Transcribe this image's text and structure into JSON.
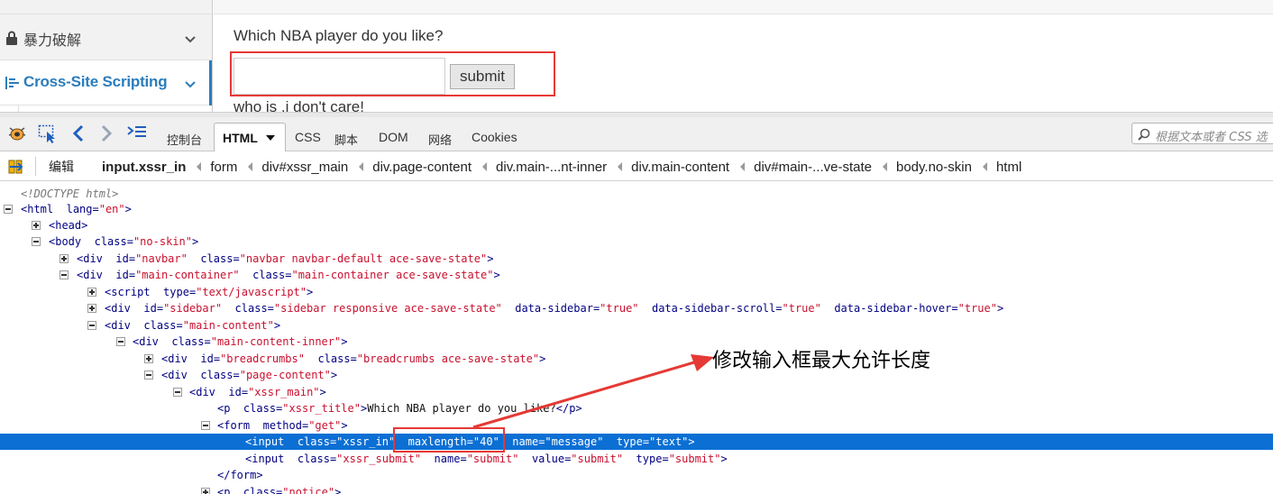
{
  "sidebar": {
    "items": [
      {
        "label": "暴力破解",
        "icon": "lock-icon",
        "active": false
      },
      {
        "label": "Cross-Site Scripting",
        "icon": "list-icon",
        "active": true
      }
    ]
  },
  "page": {
    "xss_title": "Which NBA player do you like?",
    "input_value": "",
    "submit_label": "submit",
    "notice": "who is ,i don't care!"
  },
  "devtools": {
    "tabs": {
      "console": "控制台",
      "html": "HTML",
      "css": "CSS",
      "script": "脚本",
      "dom": "DOM",
      "net": "网络",
      "cookies": "Cookies"
    },
    "search_placeholder": "根据文本或者 CSS 选",
    "edit_label": "编辑",
    "breadcrumbs": [
      "input.xssr_in",
      "form",
      "div#xssr_main",
      "div.page-content",
      "div.main-...nt-inner",
      "div.main-content",
      "div#main-...ve-state",
      "body.no-skin",
      "html"
    ],
    "tree": {
      "doctype": "<!DOCTYPE html>",
      "html": {
        "tag": "html",
        "attr1_name": "lang",
        "attr1_val": "\"en\""
      },
      "head": {
        "tag": "head"
      },
      "body": {
        "tag": "body",
        "attr1_name": "class",
        "attr1_val": "\"no-skin\""
      },
      "navbar": {
        "tag": "div",
        "attr1_name": "id",
        "attr1_val": "\"navbar\"",
        "attr2_name": "class",
        "attr2_val": "\"navbar navbar-default ace-save-state\""
      },
      "main_container": {
        "tag": "div",
        "attr1_name": "id",
        "attr1_val": "\"main-container\"",
        "attr2_name": "class",
        "attr2_val": "\"main-container ace-save-state\""
      },
      "script": {
        "tag": "script",
        "attr1_name": "type",
        "attr1_val": "\"text/javascript\""
      },
      "sidebar": {
        "tag": "div",
        "attr1_name": "id",
        "attr1_val": "\"sidebar\"",
        "attr2_name": "class",
        "attr2_val": "\"sidebar responsive ace-save-state\"",
        "attr3_name": "data-sidebar",
        "attr3_val": "\"true\"",
        "attr4_name": "data-sidebar-scroll",
        "attr4_val": "\"true\"",
        "attr5_name": "data-sidebar-hover",
        "attr5_val": "\"true\""
      },
      "main_content": {
        "tag": "div",
        "attr1_name": "class",
        "attr1_val": "\"main-content\""
      },
      "main_content_inner": {
        "tag": "div",
        "attr1_name": "class",
        "attr1_val": "\"main-content-inner\""
      },
      "breadcrumbs": {
        "tag": "div",
        "attr1_name": "id",
        "attr1_val": "\"breadcrumbs\"",
        "attr2_name": "class",
        "attr2_val": "\"breadcrumbs ace-save-state\""
      },
      "page_content": {
        "tag": "div",
        "attr1_name": "class",
        "attr1_val": "\"page-content\""
      },
      "xssr_main": {
        "tag": "div",
        "attr1_name": "id",
        "attr1_val": "\"xssr_main\""
      },
      "p_title": {
        "tag": "p",
        "attr1_name": "class",
        "attr1_val": "\"xssr_title\"",
        "text": "Which NBA player do you like?",
        "close": "p"
      },
      "form": {
        "tag": "form",
        "attr1_name": "method",
        "attr1_val": "\"get\""
      },
      "input_text": {
        "tag": "input",
        "attr1_name": "class",
        "attr1_val": "\"xssr_in\"",
        "attr2_name": "maxlength",
        "attr2_val": "\"40\"",
        "attr3_name": "name",
        "attr3_val": "\"message\"",
        "attr4_name": "type",
        "attr4_val": "\"text\""
      },
      "input_submit": {
        "tag": "input",
        "attr1_name": "class",
        "attr1_val": "\"xssr_submit\"",
        "attr2_name": "name",
        "attr2_val": "\"submit\"",
        "attr3_name": "value",
        "attr3_val": "\"submit\"",
        "attr4_name": "type",
        "attr4_val": "\"submit\""
      },
      "form_close": {
        "tag": "form"
      },
      "p_notice": {
        "tag": "p",
        "attr1_name": "class",
        "attr1_val": "\"notice\""
      }
    }
  },
  "annotation": {
    "text": "修改输入框最大允许长度",
    "color": "#e53935"
  },
  "colors": {
    "accent": "#2b7dbc",
    "selection": "#0b6fd4",
    "attr_value": "#c8102e",
    "tag": "#000080",
    "highlight_box": "#e53935"
  }
}
